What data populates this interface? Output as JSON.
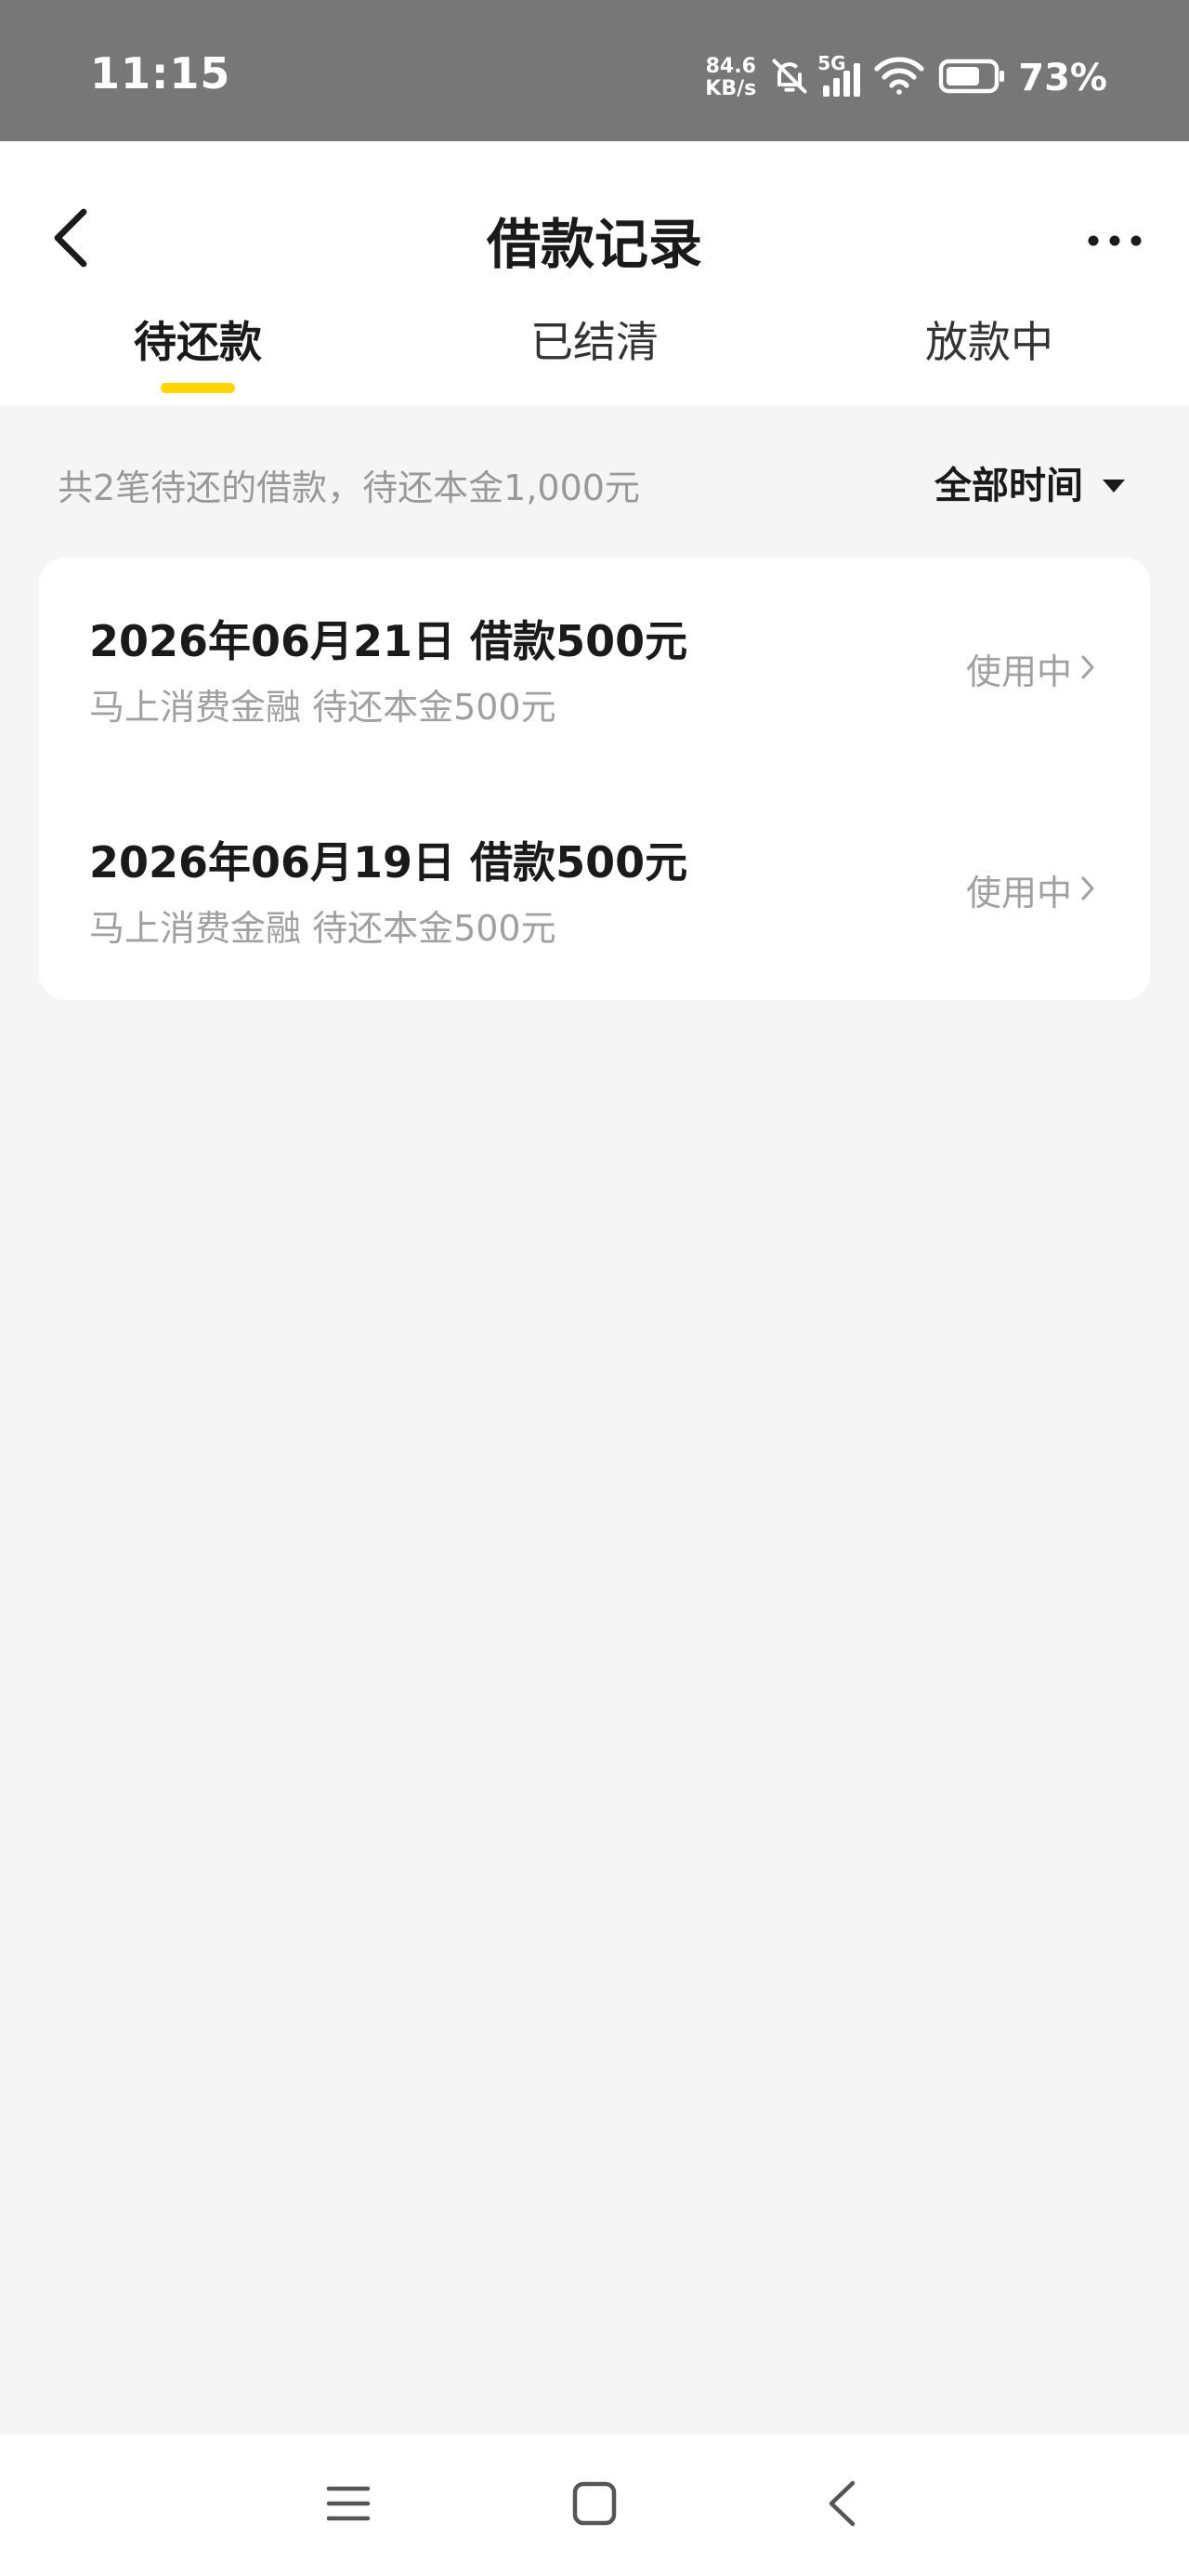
{
  "status_bar": {
    "time": "11:15",
    "net_speed_value": "84.6",
    "net_speed_unit": "KB/s",
    "network": "5G",
    "battery_percent": "73%",
    "battery_level": 0.73
  },
  "header": {
    "title": "借款记录"
  },
  "tabs": [
    {
      "label": "待还款",
      "active": true
    },
    {
      "label": "已结清",
      "active": false
    },
    {
      "label": "放款中",
      "active": false
    }
  ],
  "summary": {
    "text": "共2笔待还的借款，待还本金1,000元",
    "filter_label": "全部时间"
  },
  "loans": [
    {
      "title": "2026年06月21日 借款500元",
      "subtitle": "马上消费金融 待还本金500元",
      "status": "使用中"
    },
    {
      "title": "2026年06月19日 借款500元",
      "subtitle": "马上消费金融 待还本金500元",
      "status": "使用中"
    }
  ],
  "colors": {
    "accent": "#ffd400",
    "status_bar_bg": "#777777",
    "page_bg": "#f5f5f5",
    "muted_text": "#a0a0a0"
  },
  "icons": {
    "back": "chevron-left-icon",
    "more": "more-dots-icon",
    "filter": "triangle-down-icon",
    "row_arrow": "chevron-right-icon",
    "nav_menu": "menu-icon",
    "nav_home": "square-home-icon",
    "nav_back": "back-triangle-icon"
  }
}
